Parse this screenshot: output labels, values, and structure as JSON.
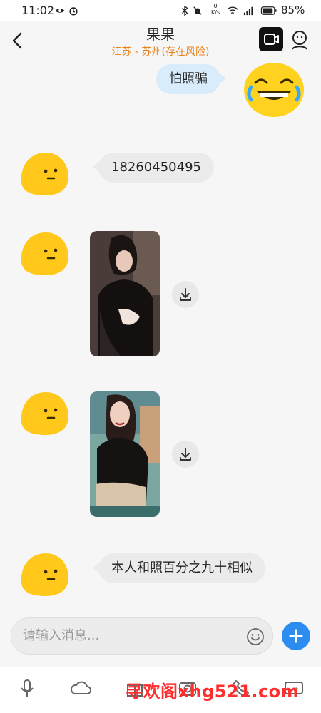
{
  "status_bar": {
    "time": "11:02",
    "battery_percent": "85%",
    "net_speed": "0 K/s",
    "icons": [
      "eye-icon",
      "alarm-icon",
      "bluetooth-icon",
      "mute-icon",
      "wifi-icon",
      "signal-icon",
      "battery-icon"
    ]
  },
  "header": {
    "title": "果果",
    "subtitle": "江苏 - 苏州(存在风险)",
    "subtitle_color": "#e8821b"
  },
  "messages": [
    {
      "side": "self",
      "type": "text",
      "text": "怕照骗"
    },
    {
      "side": "other",
      "type": "text",
      "text": "18260450495"
    },
    {
      "side": "other",
      "type": "image"
    },
    {
      "side": "other",
      "type": "image"
    },
    {
      "side": "other",
      "type": "text",
      "text": "本人和照百分之九十相似"
    }
  ],
  "input": {
    "placeholder": "请输入消息..."
  },
  "toolbar": {
    "icons": [
      "mic-icon",
      "cloud-icon",
      "gift-icon",
      "camera-icon",
      "call-icon",
      "gif-icon"
    ]
  },
  "watermark": {
    "text": "寻欢阁xhg521.com"
  },
  "colors": {
    "accent": "#2d8cf0",
    "self_bubble": "#d9ecfb",
    "other_bubble": "#ebebeb"
  }
}
